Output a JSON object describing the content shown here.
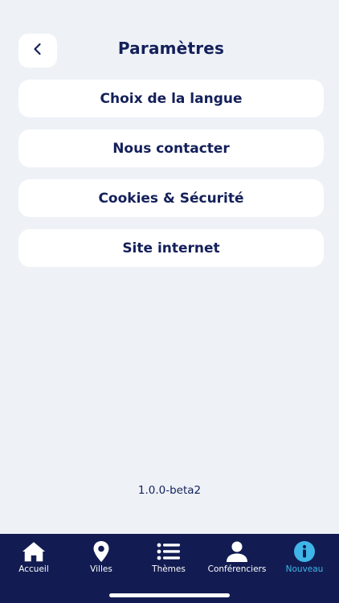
{
  "header": {
    "title": "Paramètres"
  },
  "menu": {
    "items": [
      {
        "label": "Choix de la langue"
      },
      {
        "label": "Nous contacter"
      },
      {
        "label": "Cookies & Sécurité"
      },
      {
        "label": "Site internet"
      }
    ]
  },
  "version": "1.0.0-beta2",
  "tabbar": {
    "items": [
      {
        "label": "Accueil",
        "icon": "home-icon"
      },
      {
        "label": "Villes",
        "icon": "location-pin-icon"
      },
      {
        "label": "Thèmes",
        "icon": "list-icon"
      },
      {
        "label": "Conférenciers",
        "icon": "person-icon"
      },
      {
        "label": "Nouveau",
        "icon": "info-icon",
        "active": true
      }
    ]
  },
  "colors": {
    "background": "#eef2f7",
    "card": "#ffffff",
    "text": "#14205a",
    "tabbar": "#121c52",
    "active": "#3fb5e8"
  }
}
